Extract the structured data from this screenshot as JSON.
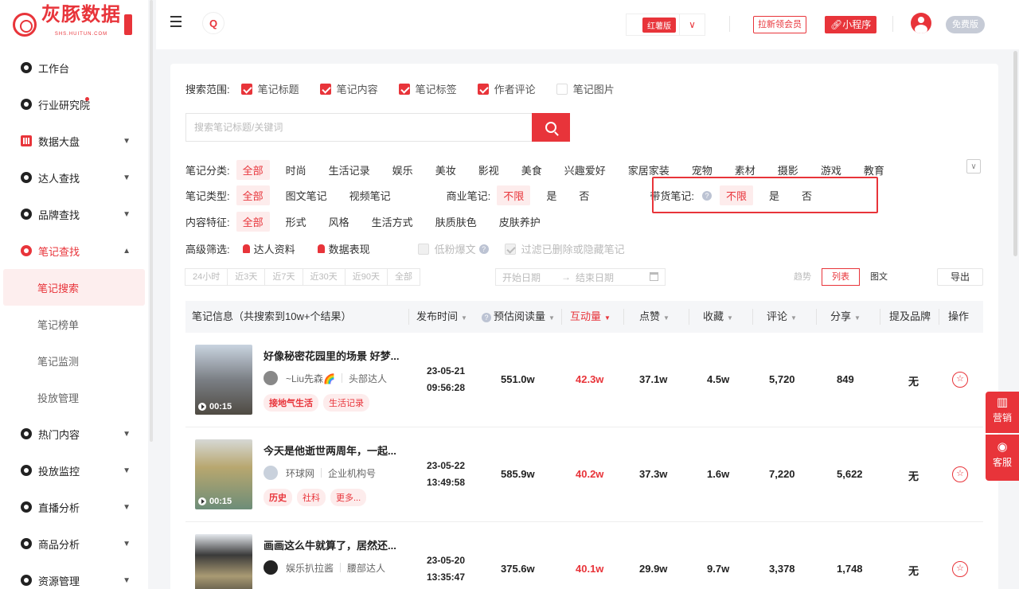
{
  "brand": {
    "name": "灰豚数据",
    "sub": "SHS.HUITUN.COM"
  },
  "sidebar": {
    "items": [
      {
        "label": "工作台"
      },
      {
        "label": "行业研究院"
      },
      {
        "label": "数据大盘"
      },
      {
        "label": "达人查找"
      },
      {
        "label": "品牌查找"
      },
      {
        "label": "笔记查找"
      }
    ],
    "sub_items": [
      {
        "label": "笔记搜索"
      },
      {
        "label": "笔记榜单"
      },
      {
        "label": "笔记监测"
      },
      {
        "label": "投放管理"
      }
    ],
    "items_after": [
      {
        "label": "热门内容"
      },
      {
        "label": "投放监控"
      },
      {
        "label": "直播分析"
      },
      {
        "label": "商品分析"
      },
      {
        "label": "资源管理"
      }
    ]
  },
  "header": {
    "search_icon": "Q",
    "version_badge": "红薯版",
    "invite_label": "拉新领会员",
    "mini_program_label": "小程序",
    "free_badge": "免费版"
  },
  "search": {
    "scope_label": "搜索范围:",
    "scopes": [
      {
        "label": "笔记标题",
        "checked": true
      },
      {
        "label": "笔记内容",
        "checked": true
      },
      {
        "label": "笔记标签",
        "checked": true
      },
      {
        "label": "作者评论",
        "checked": true
      },
      {
        "label": "笔记图片",
        "checked": false
      }
    ],
    "placeholder": "搜索笔记标题/关键词"
  },
  "filters": {
    "category_label": "笔记分类:",
    "categories": [
      "全部",
      "时尚",
      "生活记录",
      "娱乐",
      "美妆",
      "影视",
      "美食",
      "兴趣爱好",
      "家居家装",
      "宠物",
      "素材",
      "摄影",
      "游戏",
      "教育"
    ],
    "type_label": "笔记类型:",
    "types": [
      "全部",
      "图文笔记",
      "视频笔记"
    ],
    "commercial_label": "商业笔记:",
    "commercial_opts": [
      "不限",
      "是",
      "否"
    ],
    "goods_label": "带货笔记:",
    "goods_opts": [
      "不限",
      "是",
      "否"
    ],
    "feature_label": "内容特征:",
    "features": [
      "全部",
      "形式",
      "风格",
      "生活方式",
      "肤质肤色",
      "皮肤养护"
    ],
    "advanced_label": "高级筛选:",
    "advanced": [
      "达人资料",
      "数据表现"
    ],
    "low_fan_label": "低粉爆文",
    "filter_deleted_label": "过滤已删除或隐藏笔记"
  },
  "time_ranges": [
    "24小时",
    "近3天",
    "近7天",
    "近30天",
    "近90天",
    "全部"
  ],
  "date_start": "开始日期",
  "date_arrow": "→",
  "date_end": "结束日期",
  "views": [
    "趋势",
    "列表",
    "图文"
  ],
  "export_label": "导出",
  "table": {
    "columns": {
      "info": "笔记信息（共搜索到10w+个结果）",
      "publish": "发布时间",
      "est_read": "预估阅读量",
      "interact": "互动量",
      "likes": "点赞",
      "favs": "收藏",
      "comments": "评论",
      "shares": "分享",
      "brand": "提及品牌",
      "action": "操作"
    },
    "rows": [
      {
        "title": "好像秘密花园里的场景 好梦...",
        "author": "~Liu先森🌈",
        "author_type": "头部达人",
        "duration": "00:15",
        "tags": [
          "接地气生活",
          "生活记录"
        ],
        "date": "23-05-21",
        "time": "09:56:28",
        "read": "551.0w",
        "interact": "42.3w",
        "likes": "37.1w",
        "favs": "4.5w",
        "comments": "5,720",
        "shares": "849",
        "brand": "无"
      },
      {
        "title": "今天是他逝世两周年，一起...",
        "author": "环球网",
        "author_type": "企业机构号",
        "duration": "00:15",
        "tags": [
          "历史",
          "社科",
          "更多..."
        ],
        "date": "23-05-22",
        "time": "13:49:58",
        "read": "585.9w",
        "interact": "40.2w",
        "likes": "37.3w",
        "favs": "1.6w",
        "comments": "7,220",
        "shares": "5,622",
        "brand": "无"
      },
      {
        "title": "画画这么牛就算了，居然还...",
        "author": "娱乐扒拉酱",
        "author_type": "腰部达人",
        "duration": "",
        "tags": [],
        "date": "23-05-20",
        "time": "13:35:47",
        "read": "375.6w",
        "interact": "40.1w",
        "likes": "29.9w",
        "favs": "9.7w",
        "comments": "3,378",
        "shares": "1,748",
        "brand": "无"
      }
    ]
  },
  "float_panel": {
    "marketing": "营销",
    "service": "客服"
  },
  "colors": {
    "accent": "#e8343a"
  }
}
